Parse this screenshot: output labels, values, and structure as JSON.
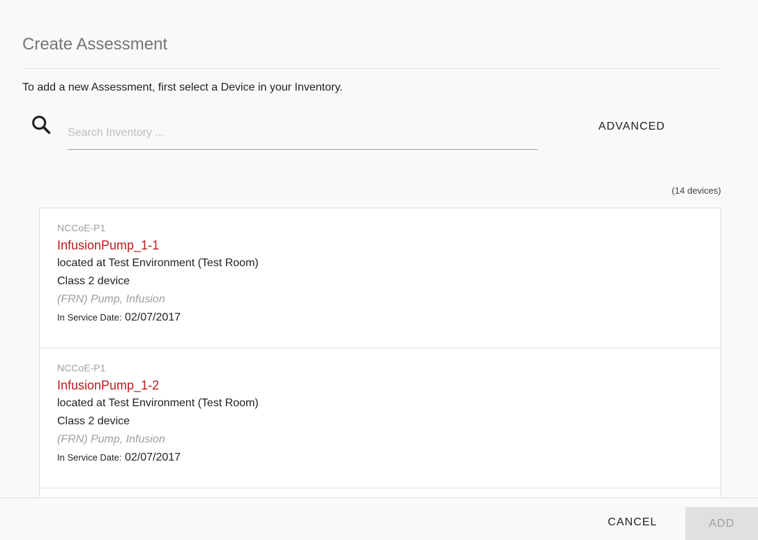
{
  "dialog": {
    "title": "Create Assessment",
    "instructions": "To add a new Assessment, first select a Device in your Inventory."
  },
  "search": {
    "placeholder": "Search Inventory ...",
    "value": "",
    "icon": "search-icon",
    "advanced_label": "ADVANCED"
  },
  "device_count": "(14 devices)",
  "devices": [
    {
      "org": "NCCoE-P1",
      "name": "InfusionPump_1-1",
      "location": "located at Test Environment (Test Room)",
      "class": "Class 2 device",
      "type": "(FRN) Pump, Infusion",
      "date_label": "In Service Date:",
      "date_value": "02/07/2017"
    },
    {
      "org": "NCCoE-P1",
      "name": "InfusionPump_1-2",
      "location": "located at Test Environment (Test Room)",
      "class": "Class 2 device",
      "type": "(FRN) Pump, Infusion",
      "date_label": "In Service Date:",
      "date_value": "02/07/2017"
    }
  ],
  "footer": {
    "cancel_label": "CANCEL",
    "add_label": "ADD"
  },
  "colors": {
    "accent": "#b71c1c",
    "background": "#f9f9f9",
    "list_background": "#ffffff"
  }
}
